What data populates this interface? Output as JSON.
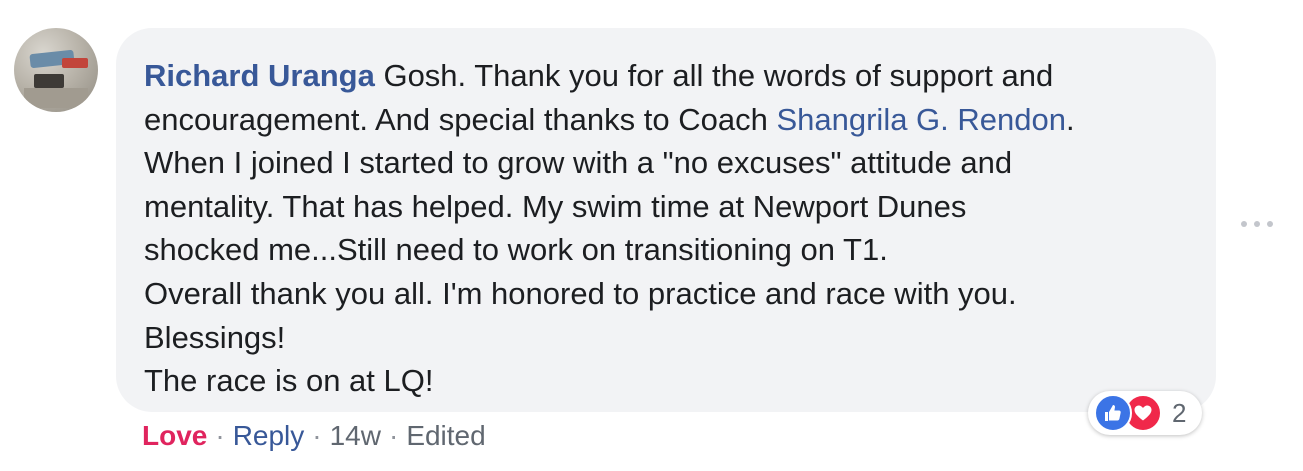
{
  "comment": {
    "author": "Richard Uranga",
    "text_before_mention": " Gosh. Thank you for all the words of support and\nencouragement. And special thanks to Coach ",
    "mention": "Shangrila G. Rendon",
    "text_after_mention": ".\nWhen I joined I started to grow with a \"no excuses\" attitude and\nmentality. That has helped. My swim time at Newport Dunes\nshocked me...Still need to work on transitioning on T1.\nOverall thank you all. I'm honored to practice and race with you.\nBlessings!\nThe race is on at LQ!"
  },
  "reactions": {
    "icons": [
      "like-icon",
      "love-icon"
    ],
    "count": "2",
    "colors": {
      "like": "#3b74e6",
      "love": "#f0284a"
    }
  },
  "actions": {
    "love": "Love",
    "separator": "·",
    "reply": "Reply",
    "time": "14w",
    "edited": "Edited"
  },
  "more_options_icon": "ellipsis-icon",
  "colors": {
    "link": "#385898",
    "love_active": "#e0245e",
    "bubble_bg": "#f2f3f5",
    "meta": "#606770"
  }
}
